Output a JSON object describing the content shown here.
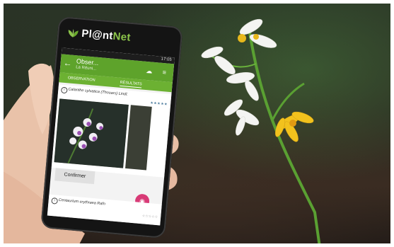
{
  "app": {
    "logo_text_a": "Pl@nt",
    "logo_text_b": "Net",
    "status_time": "17:05",
    "title": "Obser...",
    "subtitle": "La Réuni...",
    "back_glyph": "←",
    "toolbar_glyphs": "☁ ≡"
  },
  "tabs": [
    {
      "label": "OBSERVATION",
      "active": false
    },
    {
      "label": "RÉSULTATS",
      "active": true
    }
  ],
  "results": [
    {
      "species": "Calanthe sylvatica (Thouars) Lindl.",
      "stars": "★★★★★"
    },
    {
      "species": "Centaurium erythraea Rafn",
      "stars": "☆☆☆☆☆"
    }
  ],
  "confirm_label": "Confirmer",
  "info_glyph": "i",
  "camera_glyph": "◉",
  "colors": {
    "accent": "#5ea32b",
    "fab": "#d83a76"
  },
  "icons": [
    "leaf-logo-icon",
    "back-arrow-icon",
    "cloud-upload-icon",
    "menu-icon",
    "info-icon",
    "camera-icon"
  ]
}
